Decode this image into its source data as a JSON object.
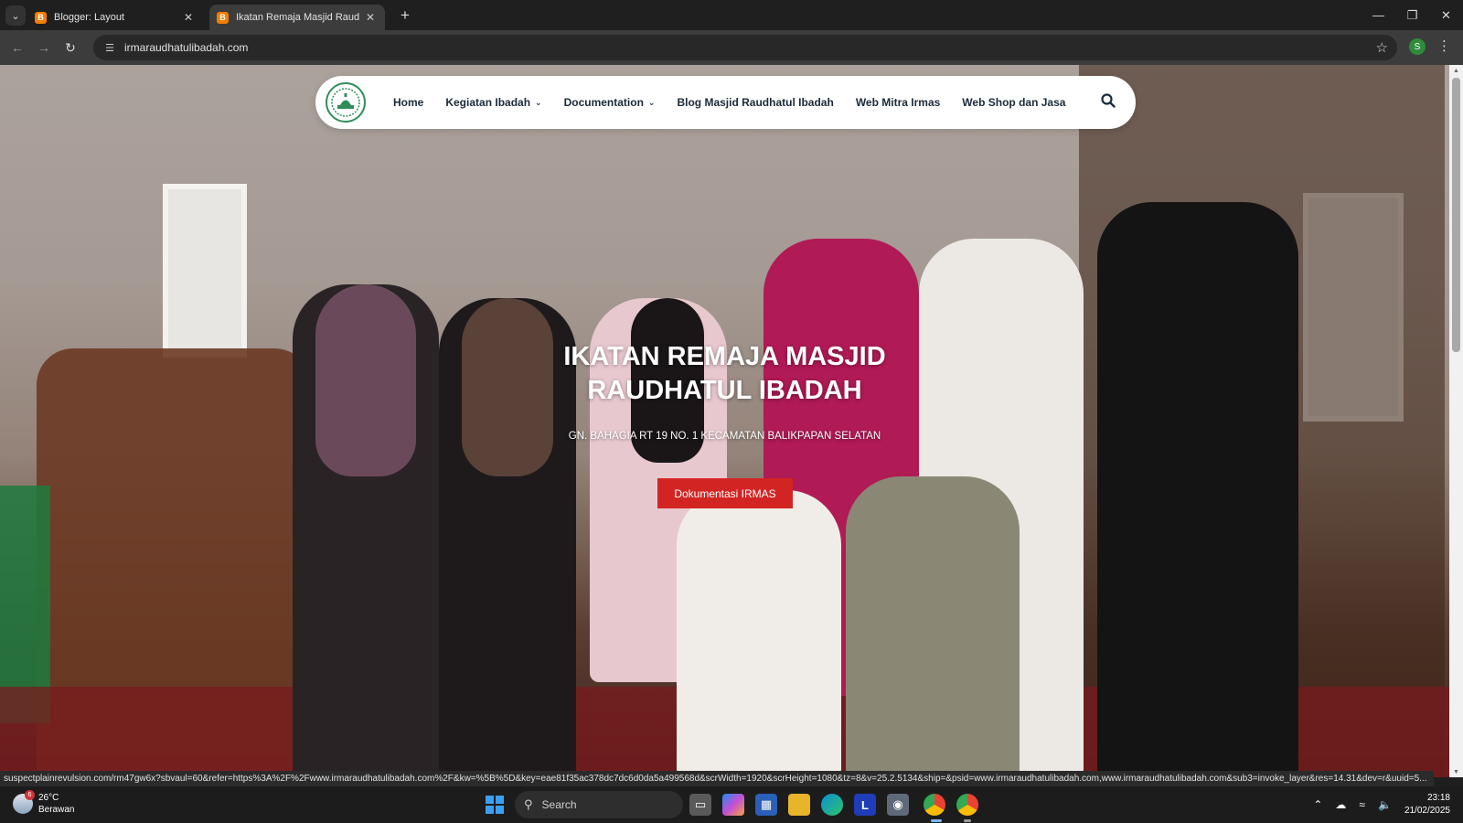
{
  "browser": {
    "tabs": [
      {
        "title": "Blogger: Layout",
        "favicon": "blogger-icon",
        "active": false
      },
      {
        "title": "Ikatan Remaja Masjid Raudhatul",
        "favicon": "blogger-icon",
        "active": true
      }
    ],
    "url": "irmaraudhatulibadah.com",
    "profile_initial": "S",
    "status_url": "suspectplainrevulsion.com/rm47gw6x?sbvaul=60&refer=https%3A%2F%2Fwww.irmaraudhatulibadah.com%2F&kw=%5B%5D&key=eae81f35ac378dc7dc6d0da5a499568d&scrWidth=1920&scrHeight=1080&tz=8&v=25.2.5134&ship=&psid=www.irmaraudhatulibadah.com,www.irmaraudhatulibadah.com&sub3=invoke_layer&res=14.31&dev=r&uuid=5..."
  },
  "site": {
    "nav": [
      {
        "label": "Home",
        "dropdown": false
      },
      {
        "label": "Kegiatan Ibadah",
        "dropdown": true
      },
      {
        "label": "Documentation",
        "dropdown": true
      },
      {
        "label": "Blog Masjid Raudhatul Ibadah",
        "dropdown": false
      },
      {
        "label": "Web Mitra Irmas",
        "dropdown": false
      },
      {
        "label": "Web Shop dan Jasa",
        "dropdown": false
      }
    ],
    "hero": {
      "title_line1": "IKATAN REMAJA MASJID",
      "title_line2": "RAUDHATUL IBADAH",
      "subtitle": "GN. BAHAGIA RT 19 NO. 1 KECAMATAN BALIKPAPAN SELATAN",
      "cta_label": "Dokumentasi IRMAS"
    },
    "colors": {
      "cta": "#d32424",
      "logo_green": "#2f8d5c",
      "nav_text": "#1b2a3a"
    }
  },
  "taskbar": {
    "weather": {
      "temp": "26°C",
      "condition": "Berawan",
      "badge": "6"
    },
    "search_label": "Search",
    "time": "23:18",
    "date": "21/02/2025"
  }
}
